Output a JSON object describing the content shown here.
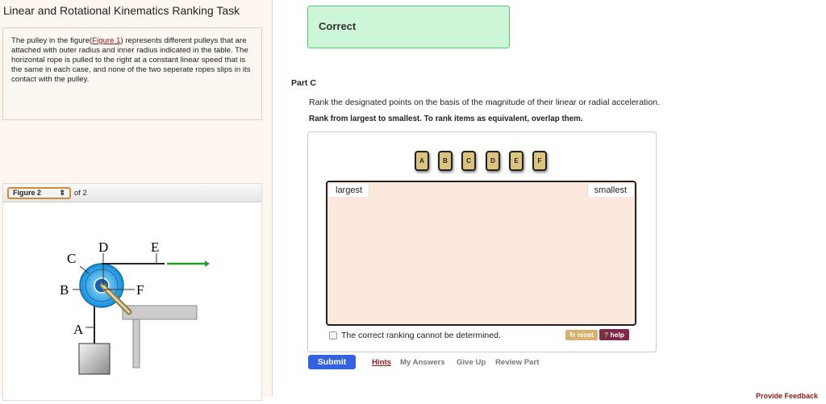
{
  "title": "Linear and Rotational Kinematics Ranking Task",
  "intro": {
    "before": "The pulley in the figure(",
    "link": "Figure 1",
    "after": ") represents different pulleys that are attached with outer radius and inner radius indicated in the table. The horizontal rope is pulled to the right at a constant linear speed that is the same in each case, and none of the two seperate ropes slips in its contact with the pulley."
  },
  "figure": {
    "selected": "Figure 2",
    "of": "of 2",
    "labels": [
      "A",
      "B",
      "C",
      "D",
      "E",
      "F"
    ]
  },
  "feedback": "Correct",
  "part": "Part C",
  "prompt": "Rank the designated points on the basis of the magnitude of their linear or radial acceleration.",
  "instruction": "Rank from largest to smallest. To rank items as equivalent, overlap them.",
  "tiles": [
    "A",
    "B",
    "C",
    "D",
    "E",
    "F"
  ],
  "largest": "largest",
  "smallest": "smallest",
  "cannot": "The correct ranking cannot be determined.",
  "reset": "reset",
  "help": "help",
  "submit": "Submit",
  "links": [
    "Hints",
    "My Answers",
    "Give Up",
    "Review Part"
  ],
  "provide_feedback": "Provide Feedback"
}
